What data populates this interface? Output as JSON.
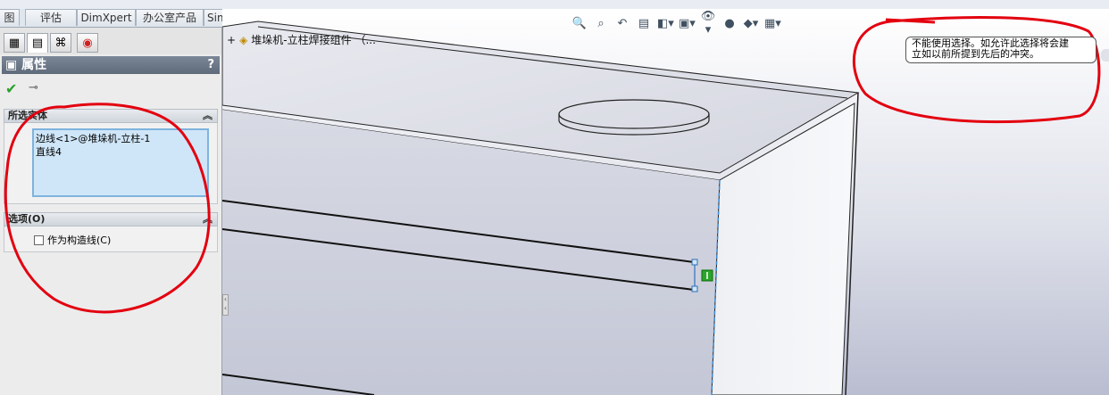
{
  "colors": {
    "viewport_bg_top": "#ffffff",
    "viewport_bg_bottom": "#b9bdd0",
    "annotation_red": "#e3000f",
    "selection_box": "#cfe6f8",
    "selection_border": "#7fb3dd",
    "ok_green": "#2ca02c"
  },
  "command_tabs": [
    {
      "label": "图"
    },
    {
      "label": "评估"
    },
    {
      "label": "DimXpert"
    },
    {
      "label": "办公室产品"
    },
    {
      "label": "Simulation"
    }
  ],
  "panel": {
    "tabs": [
      {
        "icon": "feature-manager-icon"
      },
      {
        "icon": "property-manager-icon"
      },
      {
        "icon": "configuration-manager-icon"
      },
      {
        "icon": "dimxpert-manager-icon"
      }
    ],
    "title": "属性",
    "help": "?",
    "ok_icon": "checkmark-icon",
    "pin_icon": "pushpin-icon",
    "selected_entities": {
      "header": "所选实体",
      "items": [
        "边线<1>@堆垛机-立柱-1",
        "直线4"
      ]
    },
    "options": {
      "header": "选项(O)",
      "construction_label": "作为构造线(C)",
      "construction_checked": false
    }
  },
  "viewport": {
    "tree_expand": "+",
    "tree_label": "堆垛机-立柱焊接组件 （...",
    "heads_up_icons": [
      "zoom-to-fit-icon",
      "zoom-area-icon",
      "previous-view-icon",
      "section-view-icon",
      "view-orientation-icon",
      "display-style-icon",
      "hide-show-items-icon",
      "edit-appearance-icon",
      "apply-scene-icon",
      "view-settings-icon"
    ],
    "tooltip_line1": "不能使用选择。如允许此选择将会建",
    "tooltip_line2": "立如以前所提到先后的冲突。",
    "relation_icon": "coincident-relation-icon"
  }
}
